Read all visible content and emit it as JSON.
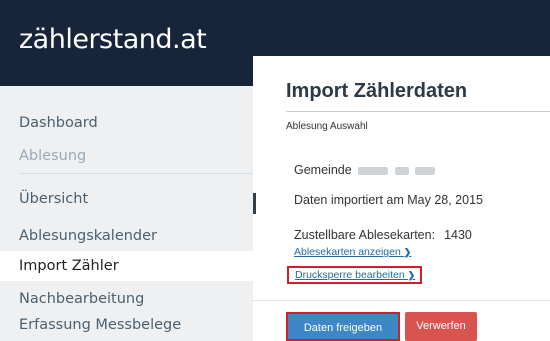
{
  "app": {
    "logo": "zählerstand.at"
  },
  "sidebar": {
    "items": [
      {
        "label": "Dashboard"
      },
      {
        "label": "Ablesung"
      },
      {
        "label": "Übersicht"
      },
      {
        "label": "Ablesungskalender"
      },
      {
        "label": "Import Zähler"
      },
      {
        "label": "Nachbearbeitung"
      },
      {
        "label": "Erfassung Messbelege"
      }
    ],
    "active_item": "Import Zähler"
  },
  "main": {
    "title": "Import Zählerdaten",
    "breadcrumb": "Ablesung Auswahl",
    "municipality_label": "Gemeinde",
    "imported_text": "Daten importiert am May 28, 2015",
    "cards_label": "Zustellbare Ablesekarten:",
    "cards_count": "1430",
    "link_show_cards": "Ablesekarten anzeigen",
    "link_edit_print_lock": "Drucksperre bearbeiten"
  },
  "actions": {
    "release_label": "Daten freigeben",
    "discard_label": "Verwerfen"
  },
  "colors": {
    "topbar": "#16253a",
    "link": "#1f6aa5",
    "primary_button": "#3d86c8",
    "danger_button": "#d9534f",
    "highlight_border": "#d0202a"
  },
  "icons": {
    "link_arrow": "chevron-right-icon"
  }
}
